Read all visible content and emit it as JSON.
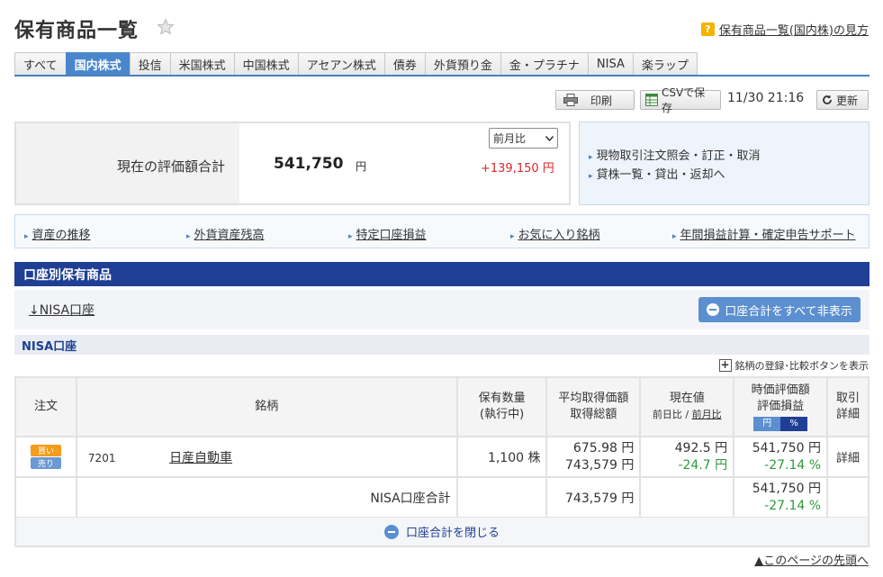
{
  "header": {
    "title": "保有商品一覧",
    "help_badge": "?",
    "help_link": "保有商品一覧(国内株)の見方"
  },
  "tabs": [
    {
      "label": "すべて"
    },
    {
      "label": "国内株式",
      "active": true
    },
    {
      "label": "投信"
    },
    {
      "label": "米国株式"
    },
    {
      "label": "中国株式"
    },
    {
      "label": "アセアン株式"
    },
    {
      "label": "債券"
    },
    {
      "label": "外貨預り金"
    },
    {
      "label": "金・プラチナ"
    },
    {
      "label": "NISA"
    },
    {
      "label": "楽ラップ"
    }
  ],
  "toolbar": {
    "print_label": "印刷",
    "csv_label": "CSVで保存",
    "timestamp": "11/30 21:16",
    "refresh_label": "更新"
  },
  "summary": {
    "label": "現在の評価額合計",
    "value": "541,750",
    "unit": "円",
    "compare_select": "前月比",
    "diff": "+139,150 円"
  },
  "side_links": [
    "現物取引注文照会・訂正・取消",
    "貸株一覧・貸出・返却へ"
  ],
  "link_bar": [
    "資産の推移",
    "外貨資産残高",
    "特定口座損益",
    "お気に入り銘柄",
    "年間損益計算・確定申告サポート"
  ],
  "section": {
    "title": "口座別保有商品",
    "account_link": "↓NISA口座",
    "hide_all_label": "口座合計をすべて非表示",
    "account_head": "NISA口座",
    "register_label": "銘柄の登録･比較ボタンを表示"
  },
  "table": {
    "headers": {
      "order": "注文",
      "name": "銘柄",
      "qty_1": "保有数量",
      "qty_2": "(執行中)",
      "avg_1": "平均取得価額",
      "avg_2": "取得総額",
      "price_1": "現在値",
      "price_2a": "前日比",
      "price_sep": "/",
      "price_2b": "前月比",
      "eval_1": "時価評価額",
      "eval_2": "評価損益",
      "toggle_yen": "円",
      "toggle_pct": "%",
      "detail_1": "取引",
      "detail_2": "詳細"
    },
    "rows": [
      {
        "buy": "買い",
        "sell": "売り",
        "code": "7201",
        "name": "日産自動車",
        "qty": "1,100 株",
        "avg_price": "675.98 円",
        "total_cost": "743,579 円",
        "price": "492.5 円",
        "price_change": "-24.7 円",
        "eval": "541,750 円",
        "pl": "-27.14 %",
        "detail": "詳細"
      }
    ],
    "total": {
      "label": "NISA口座合計",
      "total_cost": "743,579 円",
      "eval": "541,750 円",
      "pl": "-27.14 %"
    }
  },
  "close_label": "口座合計を閉じる",
  "top_link": "▲このページの先頭へ"
}
